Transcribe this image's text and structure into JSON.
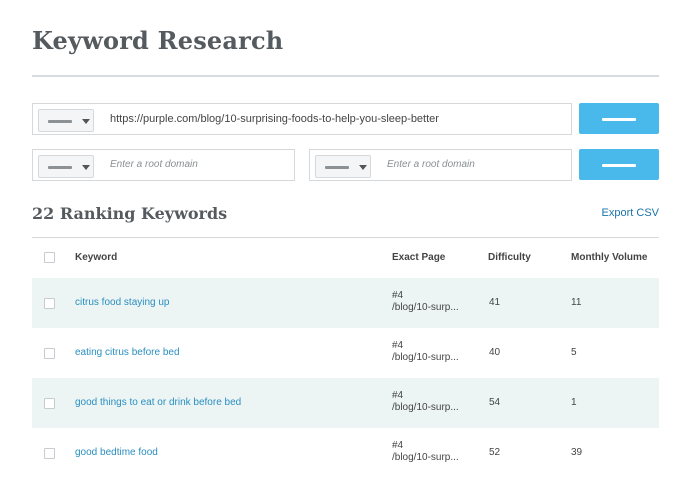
{
  "page": {
    "title": "Keyword Research"
  },
  "search": {
    "url_value": "https://purple.com/blog/10-surprising-foods-to-help-you-sleep-better",
    "root_domain_placeholder_1": "Enter a root domain",
    "root_domain_placeholder_2": "Enter a root domain"
  },
  "results": {
    "title": "22 Ranking Keywords",
    "export_label": "Export CSV",
    "columns": [
      "Keyword",
      "Exact Page",
      "Difficulty",
      "Monthly Volume"
    ],
    "rows": [
      {
        "keyword": "citrus food staying up",
        "rank": "#4",
        "page": "/blog/10-surp...",
        "difficulty": "41",
        "volume": "11"
      },
      {
        "keyword": "eating citrus before bed",
        "rank": "#4",
        "page": "/blog/10-surp...",
        "difficulty": "40",
        "volume": "5"
      },
      {
        "keyword": "good things to eat or drink before bed",
        "rank": "#4",
        "page": "/blog/10-surp...",
        "difficulty": "54",
        "volume": "1"
      },
      {
        "keyword": "good bedtime food",
        "rank": "#4",
        "page": "/blog/10-surp...",
        "difficulty": "52",
        "volume": "39"
      }
    ]
  },
  "colors": {
    "accent": "#48b9ea",
    "link": "#2a8fc0",
    "row_shade": "#ecf4f4"
  }
}
